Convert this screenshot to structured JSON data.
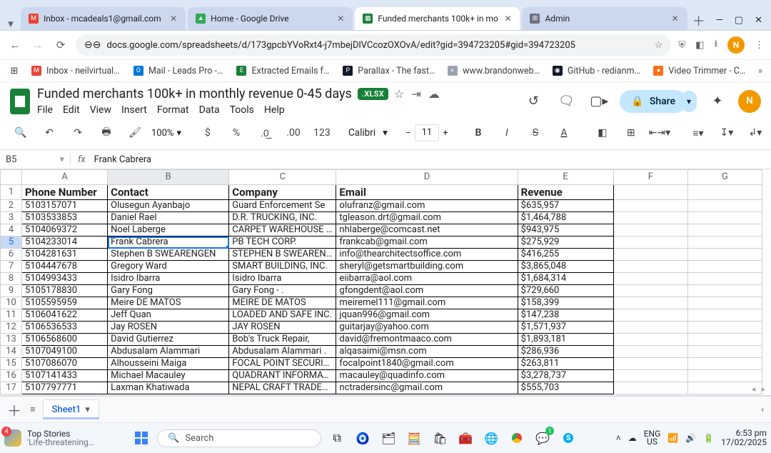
{
  "browser": {
    "tabs": [
      {
        "title": "Inbox - mcadeals1@gmail.com",
        "favicon_color": "#ea4335",
        "favicon_glyph": "M"
      },
      {
        "title": "Home - Google Drive",
        "favicon_color": "#34a853",
        "favicon_glyph": "▲"
      },
      {
        "title": "Funded merchants 100k+ in mo",
        "favicon_color": "#188038",
        "favicon_glyph": "▦",
        "active": true
      },
      {
        "title": "Admin",
        "favicon_color": "#6b7280",
        "favicon_glyph": "⊞"
      }
    ],
    "url": "docs.google.com/spreadsheets/d/173gpcbYVoRxt4-j7mbejDlVCcozOXOvA/edit?gid=394723205#gid=394723205",
    "avatar_letter": "N",
    "bookmarks": [
      {
        "label": "Inbox - neilvirtualro…",
        "favicon_color": "#ea4335",
        "favicon_glyph": "M"
      },
      {
        "label": "Mail - Leads Pro - O…",
        "favicon_color": "#0078d4",
        "favicon_glyph": "O"
      },
      {
        "label": "Extracted Emails fro…",
        "favicon_color": "#188038",
        "favicon_glyph": "E"
      },
      {
        "label": "Parallax - The fast a…",
        "favicon_color": "#111827",
        "favicon_glyph": "P"
      },
      {
        "label": "www.brandonweb.c…",
        "favicon_color": "#9ca3af",
        "favicon_glyph": "◐"
      },
      {
        "label": "GitHub - redianmar…",
        "favicon_color": "#111827",
        "favicon_glyph": "◉"
      },
      {
        "label": "Video Trimmer - Cut…",
        "favicon_color": "#f97316",
        "favicon_glyph": "●"
      }
    ],
    "apps_glyph": "⊞"
  },
  "sheets": {
    "title": "Funded merchants 100k+ in monthly revenue 0-45 days",
    "xlsx_badge": ".XLSX",
    "menus": [
      "File",
      "Edit",
      "View",
      "Insert",
      "Format",
      "Data",
      "Tools",
      "Help"
    ],
    "share_label": "Share",
    "avatar_letter": "N",
    "toolbar": {
      "zoom": "100%",
      "font": "Calibri",
      "font_size": "11"
    },
    "namebox": "B5",
    "formula_value": "Frank Cabrera",
    "active_sheet": "Sheet1",
    "column_headers": [
      "A",
      "B",
      "C",
      "D",
      "E",
      "F",
      "G"
    ],
    "data_headers": [
      "Phone Number",
      "Contact",
      "Company",
      "Email",
      "Revenue"
    ],
    "active_cell": {
      "row": 5,
      "col": "B"
    },
    "rows": [
      {
        "n": 2,
        "phone": "5103157071",
        "contact": "Olusegun Ayanbajo",
        "company": "Guard Enforcement Se",
        "email": "olufranz@gmail.com",
        "revenue": "$635,957"
      },
      {
        "n": 3,
        "phone": "5103533853",
        "contact": "Daniel Rael",
        "company": "D.R. TRUCKING, INC.",
        "email": "tgleason.drt@gmail.com",
        "revenue": "$1,464,788"
      },
      {
        "n": 4,
        "phone": "5104069372",
        "contact": "Noel Laberge",
        "company": "CARPET WAREHOUSE INC",
        "email": "nhlaberge@comcast.net",
        "revenue": "$943,975"
      },
      {
        "n": 5,
        "phone": "5104233014",
        "contact": "Frank Cabrera",
        "company": "PB TECH CORP.",
        "email": "frankcab@gmail.com",
        "revenue": "$275,929"
      },
      {
        "n": 6,
        "phone": "5104281631",
        "contact": "Stephen B SWEARENGEN",
        "company": "STEPHEN B SWEARENGEN",
        "email": "info@thearchitectsoffice.com",
        "revenue": "$416,255"
      },
      {
        "n": 7,
        "phone": "5104447678",
        "contact": "Gregory Ward",
        "company": "SMART BUILDING, INC.",
        "email": "sheryl@getsmartbuilding.com",
        "revenue": "$3,865,048"
      },
      {
        "n": 8,
        "phone": "5104993433",
        "contact": "Isidro Ibarra",
        "company": "Isidro Ibarra",
        "email": "eiibarra@aol.com",
        "revenue": "$1,684,314"
      },
      {
        "n": 9,
        "phone": "5105178830",
        "contact": "Gary Fong",
        "company": "Gary Fong - .",
        "email": "gfongdent@aol.com",
        "revenue": "$729,660"
      },
      {
        "n": 10,
        "phone": "5105595959",
        "contact": "Meire DE MATOS",
        "company": "MEIRE DE MATOS",
        "email": "meiremel111@gmail.com",
        "revenue": "$158,399"
      },
      {
        "n": 11,
        "phone": "5106041622",
        "contact": "Jeff Quan",
        "company": "LOADED AND SAFE INC.",
        "email": "jquan996@gmail.com",
        "revenue": "$147,238"
      },
      {
        "n": 12,
        "phone": "5106536533",
        "contact": "Jay ROSEN",
        "company": "JAY ROSEN",
        "email": "guitarjay@yahoo.com",
        "revenue": "$1,571,937"
      },
      {
        "n": 13,
        "phone": "5106568600",
        "contact": "David Gutierrez",
        "company": "Bob's Truck Repair,",
        "email": "david@fremontmaaco.com",
        "revenue": "$1,893,181"
      },
      {
        "n": 14,
        "phone": "5107049100",
        "contact": "Abdusalam Alammari",
        "company": "Abdusalam Alammari .",
        "email": "alqasaimi@msn.com",
        "revenue": "$286,936"
      },
      {
        "n": 15,
        "phone": "5107086070",
        "contact": "Alhousseini Maiga",
        "company": "FOCAL POINT SECURITY",
        "email": "focalpoint1840@gmail.com",
        "revenue": "$263,811"
      },
      {
        "n": 16,
        "phone": "5107141433",
        "contact": "Michael Macauley",
        "company": "QUADRANT INFORMATION",
        "email": "macauley@quadinfo.com",
        "revenue": "$3,278,737"
      },
      {
        "n": 17,
        "phone": "5107797771",
        "contact": "Laxman Khatiwada",
        "company": "NEPAL CRAFT TRADERS,",
        "email": "nctradersinc@gmail.com",
        "revenue": "$555,703"
      }
    ]
  },
  "taskbar": {
    "news_badge": "4",
    "news_line1": "Top Stories",
    "news_line2": "'Life-threatening…",
    "search_placeholder": "Search",
    "lang1": "ENG",
    "lang2": "US",
    "time": "6:53 pm",
    "date": "17/02/2025"
  }
}
